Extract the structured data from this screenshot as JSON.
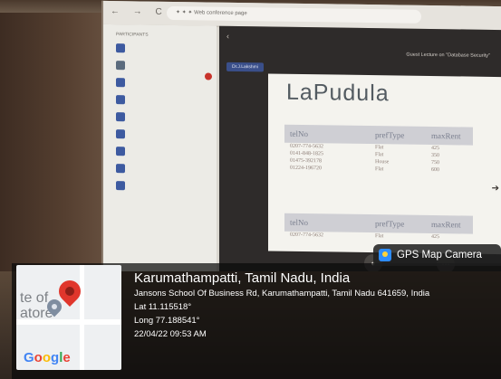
{
  "browser": {
    "url": "✦ ✦ ✦ Web conference page"
  },
  "sidebar": {
    "section_head": "Participants",
    "participants": [
      "",
      "",
      "",
      "",
      "",
      "",
      "",
      "",
      ""
    ]
  },
  "meeting": {
    "back_label": "‹",
    "title": "Guest Lecture on \"Database Security\"",
    "presenter_chip": "Dr.J.Lakshmi"
  },
  "slide": {
    "title": "LaPudula",
    "table1": {
      "headers": [
        "telNo",
        "prefType",
        "maxRent"
      ],
      "rows": [
        [
          "0207-774-5632",
          "Flat",
          "425"
        ],
        [
          "0141-848-1825",
          "Flat",
          "350"
        ],
        [
          "01475-392178",
          "House",
          "750"
        ],
        [
          "01224-196720",
          "Flat",
          "600"
        ]
      ]
    },
    "table2": {
      "headers": [
        "telNo",
        "prefType",
        "maxRent"
      ],
      "rows": [
        [
          "0207-774-5632",
          "Flat",
          "425"
        ]
      ]
    }
  },
  "stamp": {
    "app_label": "GPS Map Camera",
    "city": "Karumathampatti, Tamil Nadu, India",
    "address": "Jansons School Of Business Rd, Karumathampatti, Tamil Nadu 641659, India",
    "lat": "Lat 11.115518°",
    "long": "Long 77.188541°",
    "datetime": "22/04/22 09:53 AM",
    "map_place": "te of\natore",
    "map_brand": "Google"
  }
}
